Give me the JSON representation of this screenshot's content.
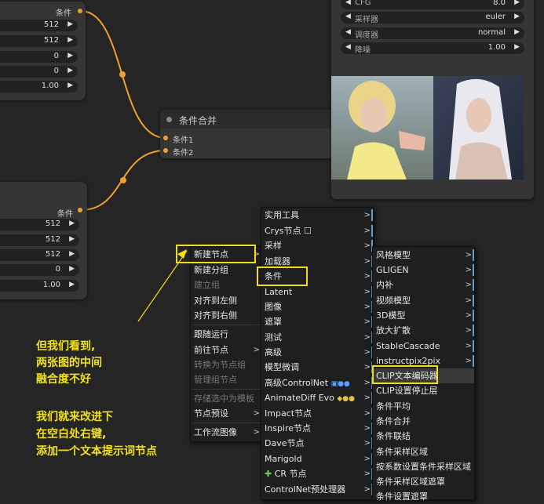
{
  "top_left_node": {
    "output_label": "条件",
    "values": [
      "512",
      "512",
      "0",
      "0",
      "1.00"
    ]
  },
  "bottom_left_node": {
    "output_label": "条件",
    "values": [
      "512",
      "512",
      "512",
      "0",
      "1.00"
    ]
  },
  "combine_node": {
    "title": "条件合并",
    "inputs": [
      "条件1",
      "条件2"
    ]
  },
  "sampler_node": {
    "rows": [
      {
        "label": "CFG",
        "value": "8.0"
      },
      {
        "label": "采样器",
        "value": "euler"
      },
      {
        "label": "调度器",
        "value": "normal"
      },
      {
        "label": "降噪",
        "value": "1.00"
      }
    ]
  },
  "context_menu": {
    "items": [
      {
        "label": "新建节点",
        "sub": true,
        "disabled": false
      },
      {
        "label": "新建分组",
        "sub": false,
        "disabled": false
      },
      {
        "label": "建立组",
        "sub": false,
        "disabled": true
      },
      {
        "label": "对齐到左侧",
        "sub": false,
        "disabled": false
      },
      {
        "label": "对齐到右侧",
        "sub": false,
        "disabled": false
      },
      {
        "label": "跟随运行",
        "sub": false,
        "disabled": false
      },
      {
        "label": "前往节点",
        "sub": true,
        "disabled": false
      },
      {
        "label": "转换为节点组",
        "sub": false,
        "disabled": true
      },
      {
        "label": "管理组节点",
        "sub": false,
        "disabled": true
      },
      {
        "label": "存储选中为模板",
        "sub": false,
        "disabled": true
      },
      {
        "label": "节点预设",
        "sub": true,
        "disabled": false
      },
      {
        "label": "工作流图像",
        "sub": true,
        "disabled": false
      }
    ]
  },
  "category_menu": {
    "items": [
      "实用工具",
      "Crys节点 ☐",
      "采样",
      "加载器",
      "条件",
      "Latent",
      "图像",
      "遮罩",
      "测试",
      "高级",
      "模型微调",
      "高级ControlNet",
      "AnimateDiff Evo",
      "Impact节点",
      "Inspire节点",
      "Dave节点",
      "Marigold",
      "CR 节点",
      "ControlNet预处理器"
    ]
  },
  "condition_menu": {
    "items": [
      "风格模型",
      "GLIGEN",
      "内补",
      "视频模型",
      "3D模型",
      "放大扩散",
      "StableCascade",
      "instructpix2pix",
      "CLIP文本编码器",
      "CLIP设置停止层",
      "条件平均",
      "条件合并",
      "条件联结",
      "条件采样区域",
      "按系数设置条件采样区域",
      "条件采样区域遮罩",
      "条件设置遮罩"
    ]
  },
  "annotation": {
    "line1": "但我们看到,",
    "line2": "两张图的中间",
    "line3": "融合度不好",
    "line4": "我们就来改进下",
    "line5": "在空白处右键,",
    "line6": "添加一个文本提示词节点"
  },
  "colors": {
    "highlight": "#f2dd1c",
    "wire": "#f0a030"
  }
}
